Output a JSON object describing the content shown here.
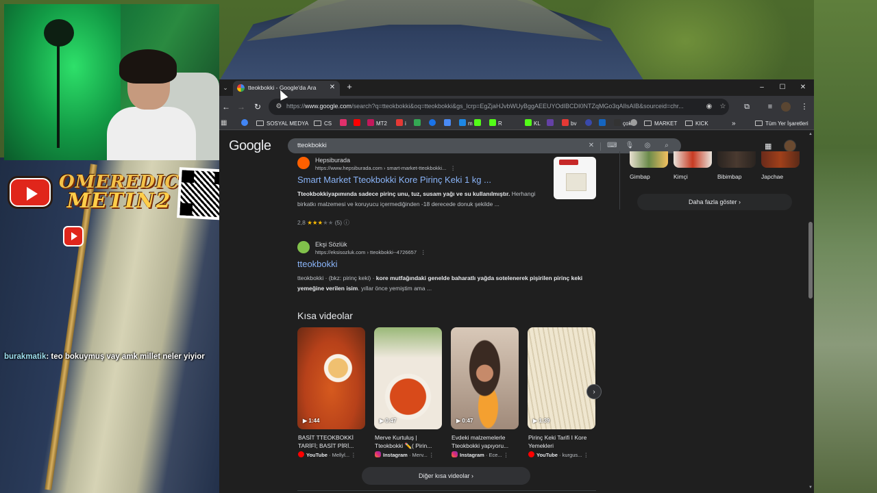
{
  "stream": {
    "sponsor_line1": "OMEREDIC",
    "sponsor_line2": "METIN2",
    "chat_user": "burakmatik",
    "chat_message": ": teo bokuymuş vay amk millet neler yiyior"
  },
  "browser": {
    "tab_title": "tteokbokki - Google'da Ara",
    "tab_close": "✕",
    "new_tab": "+",
    "win_min": "–",
    "win_max": "☐",
    "win_close": "✕",
    "url_prefix": "https://",
    "url_host": "www.google.com",
    "url_rest": "/search?q=tteokbokki&oq=tteokbokki&gs_lcrp=EgZjaHJvbWUyBggAEEUYOdIBCDI0NTZqMGo3qAIlsAIB&sourceid=chr...",
    "bookmarks": [
      {
        "label": "",
        "color": "#4285f4"
      },
      {
        "label": "SOSYAL MEDYA",
        "folder": true
      },
      {
        "label": "CS",
        "folder": true
      },
      {
        "label": "",
        "color": "#e1306c"
      },
      {
        "label": "",
        "color": "#ff0000"
      },
      {
        "label": "MT2",
        "color": "#c2185b"
      },
      {
        "label": "i",
        "color": "#e53935"
      },
      {
        "label": "",
        "color": "#34a853"
      },
      {
        "label": "",
        "color": "#1a73e8"
      },
      {
        "label": "",
        "color": "#4a8af4"
      },
      {
        "label": "m",
        "color": "#1e88e5"
      },
      {
        "label": "",
        "color": "#53fc18"
      },
      {
        "label": "R",
        "color": "#53fc18"
      },
      {
        "label": "KL",
        "color": "#53fc18"
      },
      {
        "label": "",
        "color": "#6441a5"
      },
      {
        "label": "bv",
        "color": "#e53935"
      },
      {
        "label": "",
        "color": "#3949ab"
      },
      {
        "label": "",
        "color": "#1565c0"
      },
      {
        "label": "çok",
        "color": "#333333"
      },
      {
        "label": "",
        "color": "#9e9e9e"
      },
      {
        "label": "MARKET",
        "folder": true
      },
      {
        "label": "KICK",
        "folder": true
      }
    ],
    "bookmarks_more": "»",
    "all_bookmarks": "Tüm Yer İşaretleri"
  },
  "google": {
    "logo": "Google",
    "query": "tteokbokki",
    "results": [
      {
        "site": "Hepsiburada",
        "url": "https://www.hepsiburada.com › smart-market-tteokbokki...",
        "title": "Smart Market Tteokbokki Kore Pirinç Keki 1 kg ...",
        "snippet_bold": "Tteokbokkiyapımında sadece pirinç unu, tuz, susam yağı ve su kullanılmıştır.",
        "snippet_rest": " Herhangi birkatkı malzemesi ve koruyucu içermediğinden -18 derecede donuk şekilde ...",
        "rating": "2,8",
        "reviews": "(5)",
        "fav_color": "#ff6000",
        "stars": 3
      },
      {
        "site": "Ekşi Sözlük",
        "url": "https://eksisozluk.com › tteokbokki--4726657",
        "title": "tteokbokki",
        "snippet_pre": "tteokbokki · (bkz: pirinç keki) · ",
        "snippet_bold": "kore mutfağındaki genelde baharatlı yağda sotelenerek pişirilen pirinç keki yemeğine verilen isim",
        "snippet_rest": ". yıllar önce yemiştim ama ...",
        "fav_color": "#81c14b"
      }
    ],
    "shorts_heading": "Kısa videolar",
    "shorts": [
      {
        "duration": "1:44",
        "title": "BASİT TTEOKBOKKİ TARİFİ; BASİT PİRİ...",
        "source": "YouTube",
        "author": "Mellyl...",
        "src_type": "yt"
      },
      {
        "duration": "0:47",
        "title": "Merve Kurtuluş | Tteokbokki ✏️( Pirin...",
        "source": "Instagram",
        "author": "Merv...",
        "src_type": "ig"
      },
      {
        "duration": "0:47",
        "title": "Evdeki malzemelerle Tteokbokki yapıyoru...",
        "source": "Instagram",
        "author": "Ece...",
        "src_type": "ig"
      },
      {
        "duration": "1:39",
        "title": "Pirinç Keki Tarifi I Kore Yemekleri",
        "source": "YouTube",
        "author": "kurgus...",
        "src_type": "yt"
      }
    ],
    "more_shorts": "Diğer kısa videolar",
    "knowledge_panel": {
      "items": [
        "Gimbap",
        "Kimçi",
        "Bibimbap",
        "Japchae"
      ],
      "show_more": "Daha fazla göster"
    }
  }
}
